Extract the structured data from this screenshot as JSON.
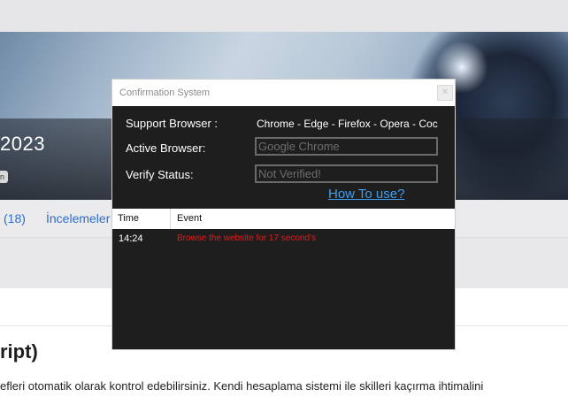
{
  "background_page": {
    "title": "2023",
    "badge": "n",
    "tabs": [
      {
        "label": "(18)"
      },
      {
        "label": "İncelemeler"
      }
    ],
    "heading": "ript)",
    "paragraph": "efleri otomatik olarak kontrol edebilirsiniz. Kendi hesaplama sistemi ile skilleri kaçırma ihtimalini"
  },
  "dialog": {
    "title": "Confirmation System",
    "close_label": "✕",
    "support_browser": {
      "label": "Support Browser :",
      "value": "Chrome - Edge - Firefox - Opera - Coc"
    },
    "active_browser": {
      "label": "Active Browser:",
      "value": "Google Chrome"
    },
    "verify_status": {
      "label": "Verify Status:",
      "value": "Not Verified!"
    },
    "howto_link": "How To use?",
    "log": {
      "columns": {
        "time": "Time",
        "event": "Event"
      },
      "rows": [
        {
          "time": "14:24",
          "event": "Browse the website for 17 second's"
        }
      ]
    }
  },
  "colors": {
    "dialog_bg": "#1e1e1e",
    "link": "#3f9ff2",
    "log_event_text": "#e81818",
    "tab_link": "#2c6ec9"
  }
}
